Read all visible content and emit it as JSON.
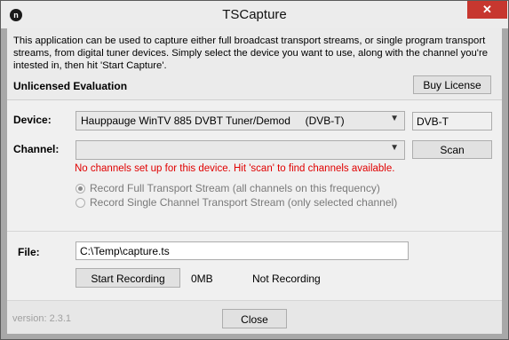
{
  "window": {
    "title": "TSCapture",
    "app_icon_glyph": "n",
    "close_glyph": "✕"
  },
  "info": {
    "description": "This application can be used to capture either full broadcast transport streams, or single program transport streams, from digital tuner devices. Simply select the device you want to use, along with the channel you're intested in, then hit 'Start Capture'.",
    "license_status": "Unlicensed Evaluation",
    "buy_license_label": "Buy License"
  },
  "device": {
    "label": "Device:",
    "selected": "Hauppauge WinTV 885 DVBT Tuner/Demod     (DVB-T)",
    "type_value": "DVB-T"
  },
  "channel": {
    "label": "Channel:",
    "selected": "",
    "scan_label": "Scan",
    "error_message": "No channels set up for this device. Hit 'scan' to find channels available."
  },
  "record_mode": {
    "options": [
      {
        "label": "Record Full Transport Stream (all channels on this frequency)",
        "checked": true
      },
      {
        "label": "Record Single Channel Transport Stream (only selected channel)",
        "checked": false
      }
    ]
  },
  "file": {
    "label": "File:",
    "path": "C:\\Temp\\capture.ts"
  },
  "recording": {
    "start_label": "Start Recording",
    "size": "0MB",
    "status": "Not Recording"
  },
  "footer": {
    "version": "version: 2.3.1",
    "close_label": "Close"
  },
  "colors": {
    "error": "#e00000",
    "close_button": "#c7372f"
  },
  "icons": {
    "dropdown": "chevron-down-icon",
    "app": "app-icon",
    "close": "close-icon"
  }
}
